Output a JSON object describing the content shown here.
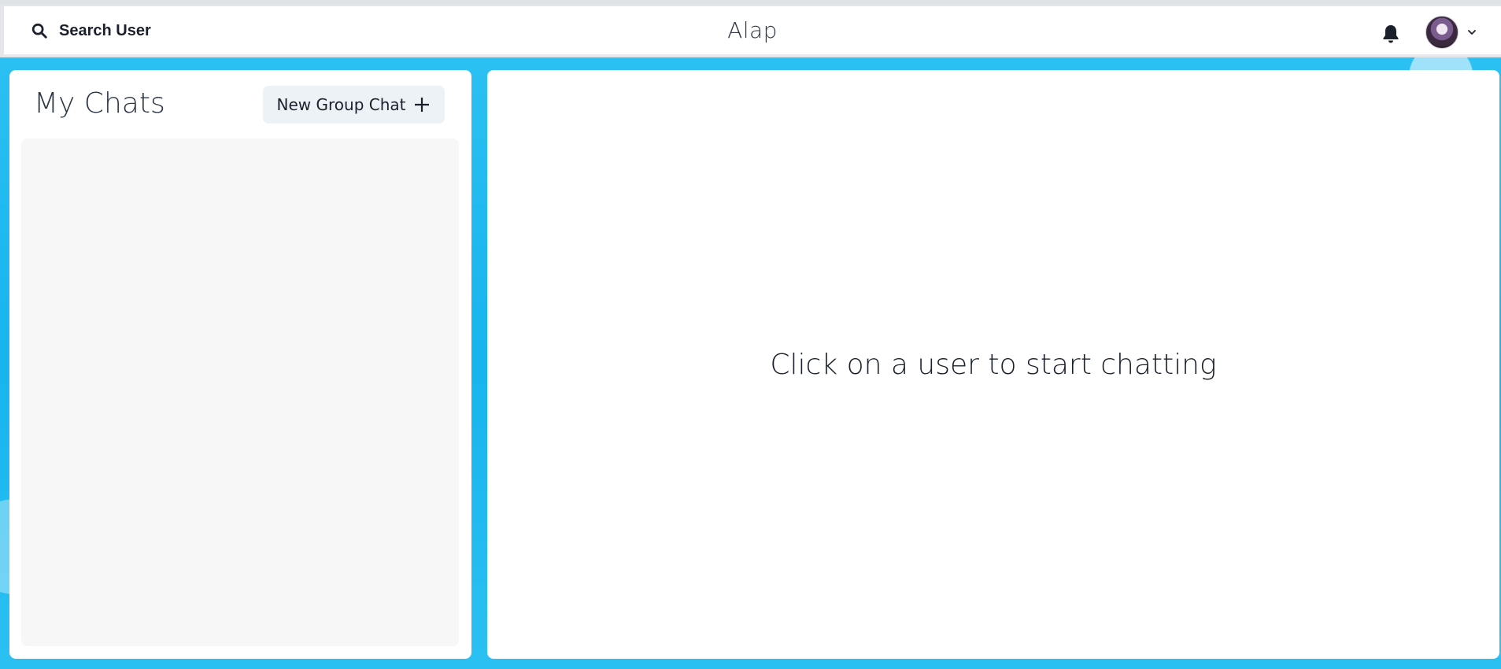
{
  "header": {
    "search_label": "Search User",
    "app_title": "Alap",
    "icons": {
      "search": "search-icon",
      "notifications": "bell-icon",
      "profile_menu": "chevron-down-icon"
    }
  },
  "sidebar": {
    "title": "My Chats",
    "new_group_label": "New Group Chat",
    "new_group_icon": "plus-icon",
    "chats": []
  },
  "chat_box": {
    "placeholder": "Click on a user to start chatting"
  },
  "colors": {
    "background_accent": "#17b4ee",
    "panel": "#ffffff",
    "button_bg": "#edf2f7",
    "list_bg": "#f7f7f8"
  }
}
